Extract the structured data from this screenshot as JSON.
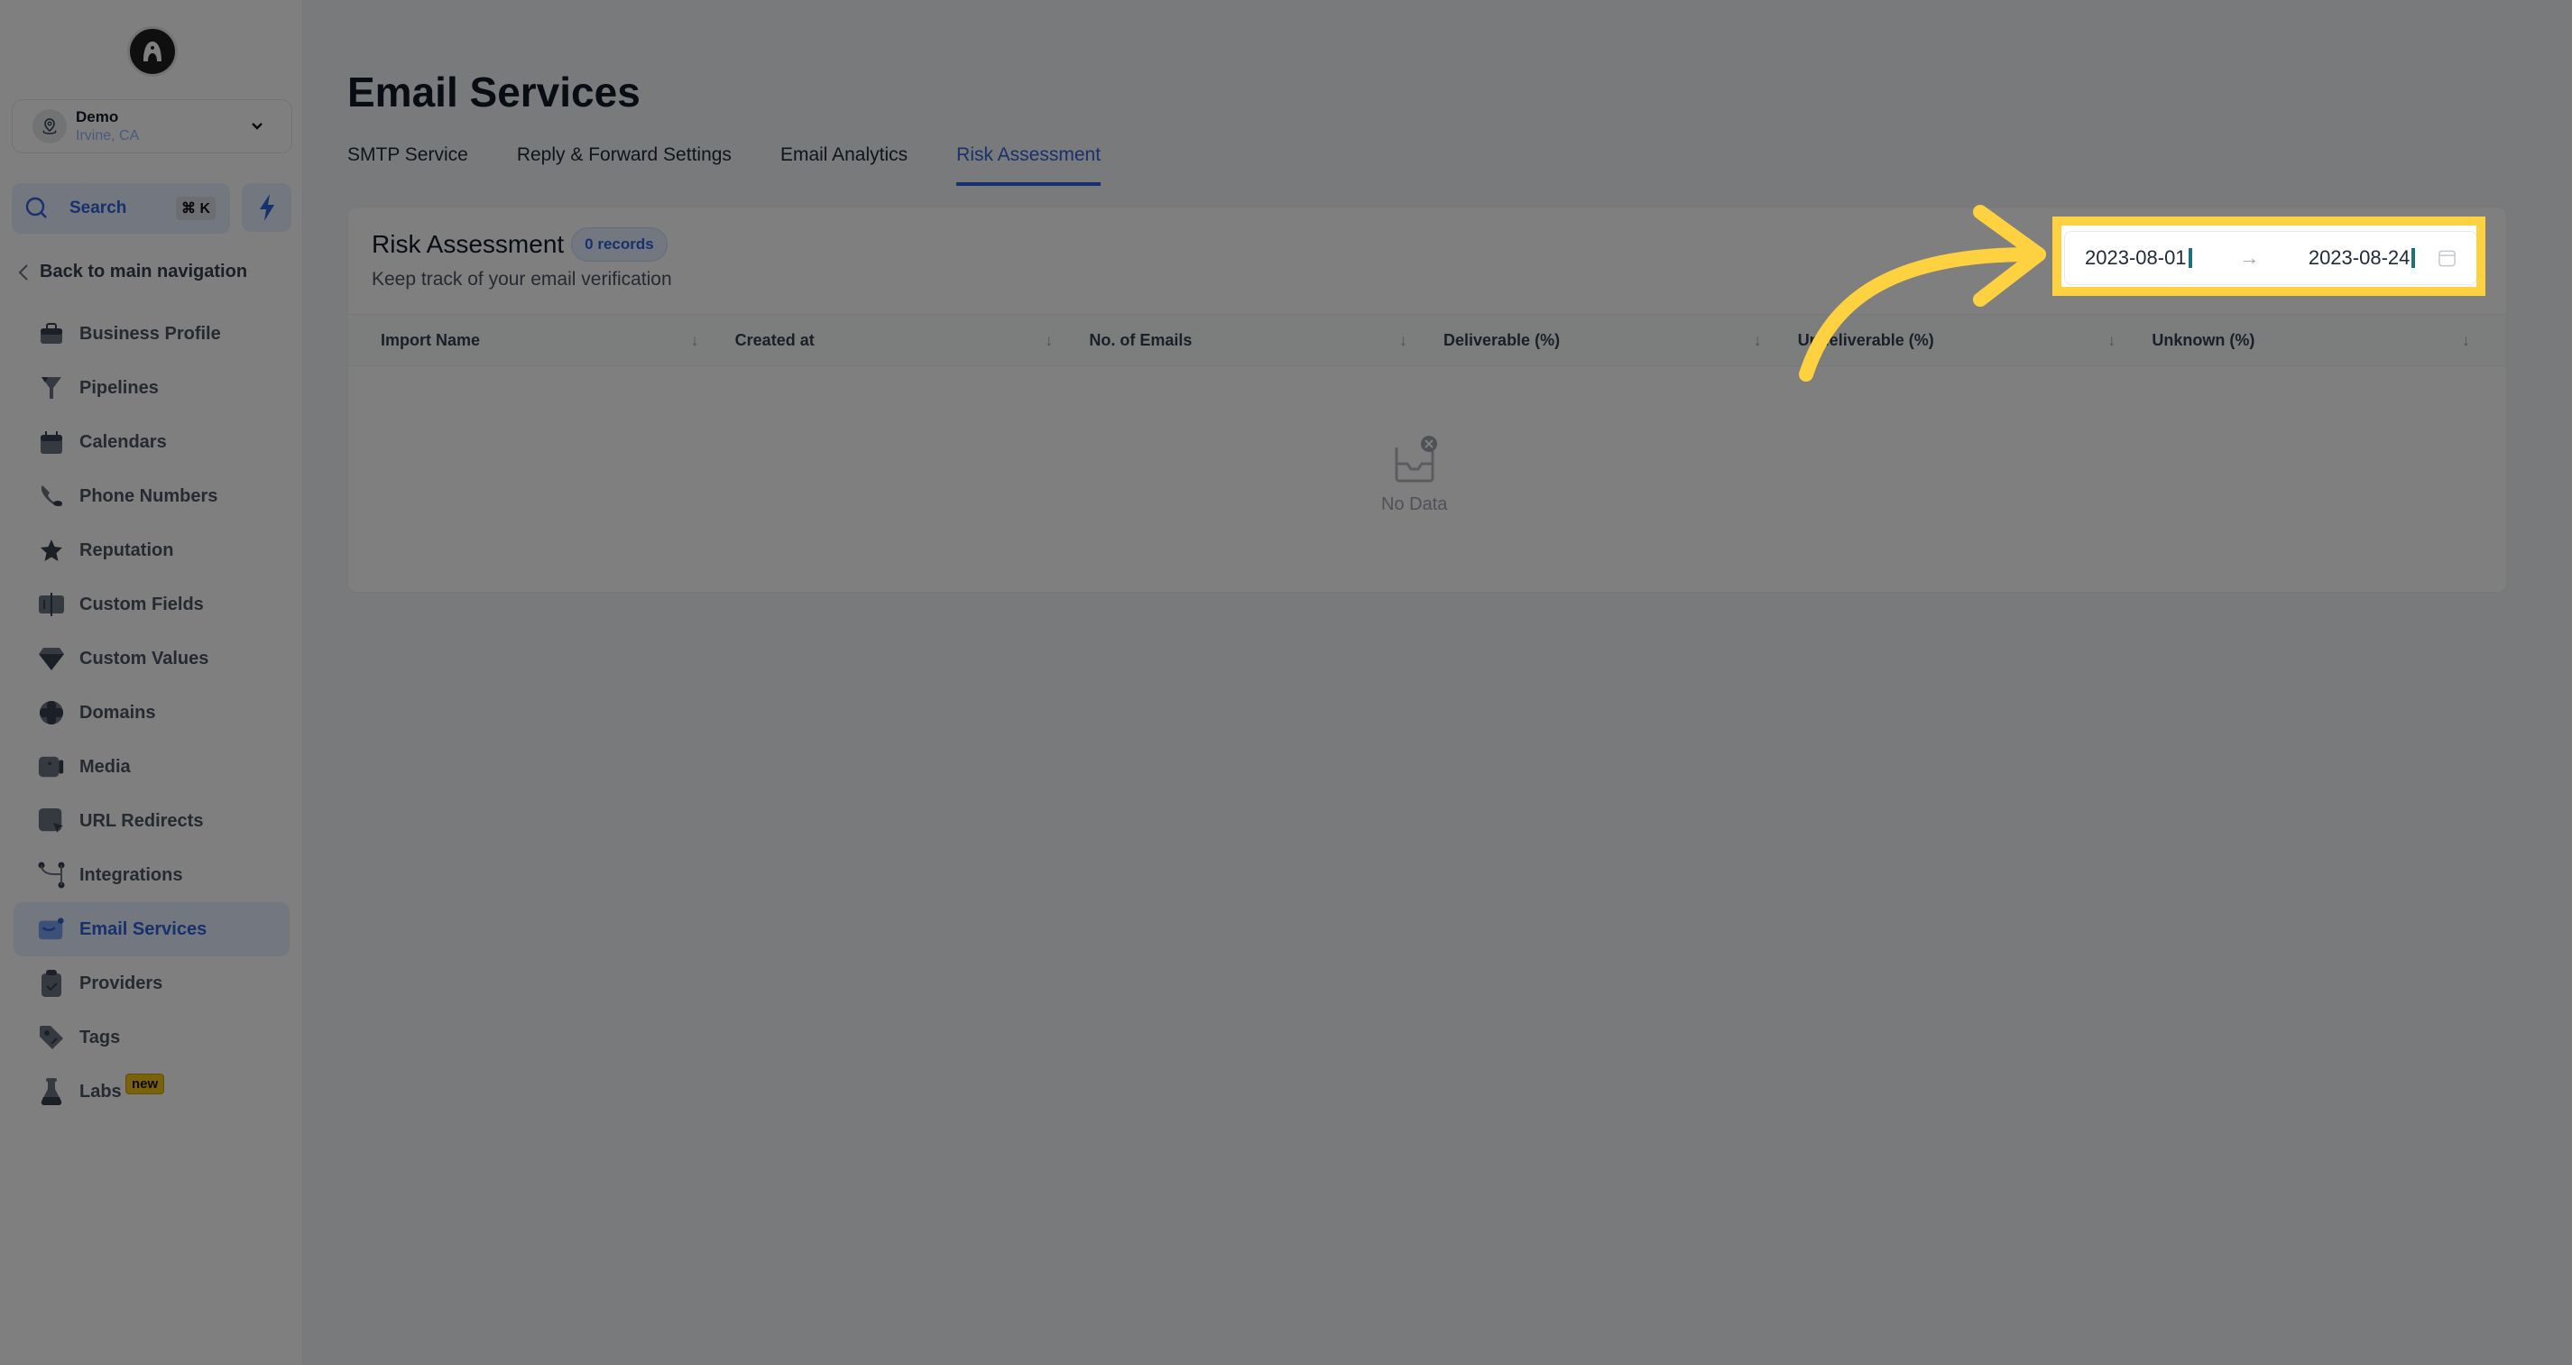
{
  "sidebar": {
    "account": {
      "name": "Demo",
      "location": "Irvine, CA"
    },
    "search": {
      "label": "Search",
      "shortcut": "⌘ K"
    },
    "back_label": "Back to main navigation",
    "items": [
      {
        "label": "Business Profile",
        "icon": "briefcase-icon"
      },
      {
        "label": "Pipelines",
        "icon": "funnel-icon"
      },
      {
        "label": "Calendars",
        "icon": "calendar-icon"
      },
      {
        "label": "Phone Numbers",
        "icon": "phone-icon"
      },
      {
        "label": "Reputation",
        "icon": "star-icon"
      },
      {
        "label": "Custom Fields",
        "icon": "fields-icon"
      },
      {
        "label": "Custom Values",
        "icon": "diamond-icon"
      },
      {
        "label": "Domains",
        "icon": "globe-icon"
      },
      {
        "label": "Media",
        "icon": "video-icon"
      },
      {
        "label": "URL Redirects",
        "icon": "redirect-icon"
      },
      {
        "label": "Integrations",
        "icon": "integrations-icon"
      },
      {
        "label": "Email Services",
        "icon": "mail-icon",
        "active": true
      },
      {
        "label": "Providers",
        "icon": "clipboard-icon"
      },
      {
        "label": "Tags",
        "icon": "tag-icon"
      },
      {
        "label": "Labs",
        "icon": "flask-icon",
        "badge": "new"
      }
    ]
  },
  "main": {
    "title": "Email Services",
    "tabs": [
      {
        "label": "SMTP Service"
      },
      {
        "label": "Reply & Forward Settings"
      },
      {
        "label": "Email Analytics"
      },
      {
        "label": "Risk Assessment",
        "active": true
      }
    ],
    "card": {
      "title": "Risk Assessment",
      "records_badge": "0 records",
      "subtitle": "Keep track of your email verification",
      "date_range": {
        "start": "2023-08-01",
        "end": "2023-08-24",
        "separator": "→"
      },
      "columns": [
        "Import Name",
        "Created at",
        "No. of Emails",
        "Deliverable (%)",
        "Undeliverable (%)",
        "Unknown (%)"
      ],
      "sort_glyph": "↓",
      "empty_text": "No Data"
    }
  },
  "colors": {
    "accent": "#2f63d9",
    "highlight": "#fdd13f",
    "overlay": "#000000"
  }
}
